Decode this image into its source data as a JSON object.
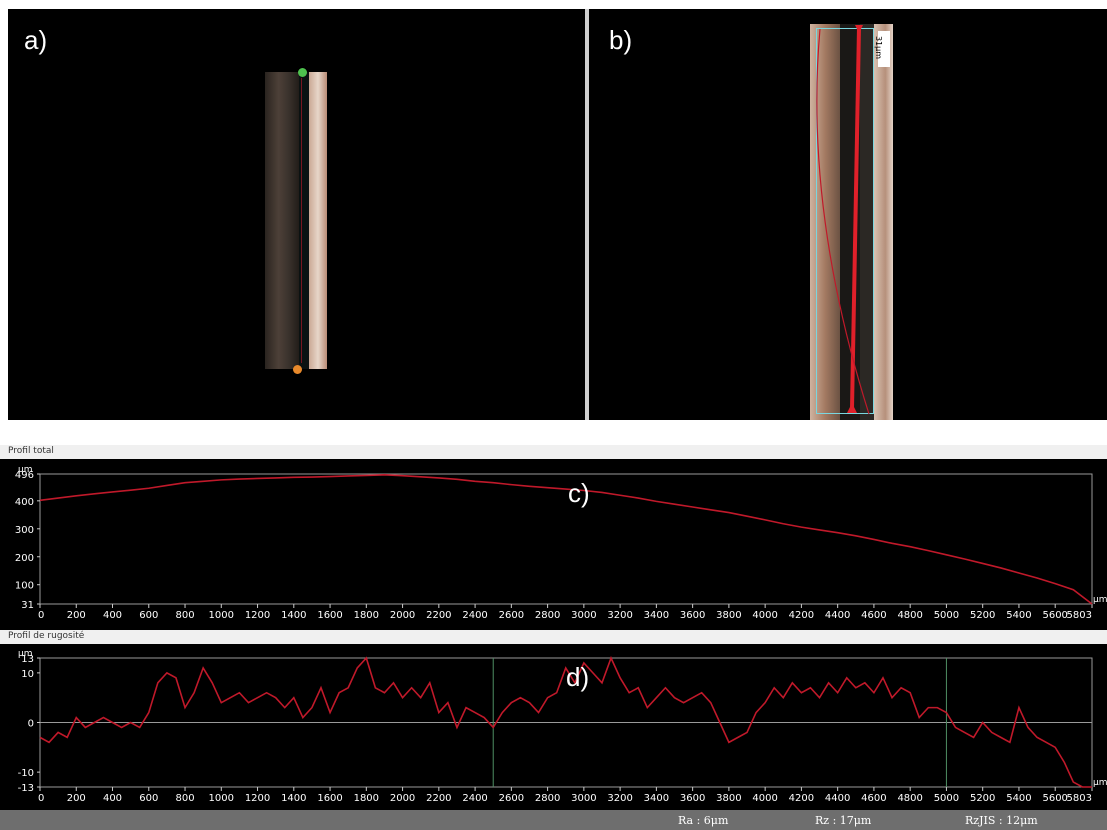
{
  "panels": {
    "a_label": "a)",
    "b_label": "b)",
    "c_label": "c)",
    "d_label": "d)",
    "b_marker_text": "31μm"
  },
  "colors": {
    "profile_line": "#c0192a",
    "grid_line": "#9a9a9a",
    "green_marker": "#4ec24e",
    "orange_marker": "#e8892b",
    "cyan_box": "#7ad7e0",
    "red_marker": "#e0202a"
  },
  "chart_data": [
    {
      "type": "line",
      "title": "Profil total",
      "ylabel": "μm",
      "xlabel": "μm",
      "xlim": [
        0,
        5803
      ],
      "ylim": [
        31,
        496
      ],
      "xticks": [
        "0",
        "200",
        "400",
        "600",
        "800",
        "1000",
        "1200",
        "1400",
        "1600",
        "1800",
        "2000",
        "2200",
        "2400",
        "2600",
        "2800",
        "3000",
        "3200",
        "3400",
        "3600",
        "3800",
        "4000",
        "4200",
        "4400",
        "4600",
        "4800",
        "5000",
        "5200",
        "5400",
        "5600",
        "5803"
      ],
      "yticks": [
        "496",
        "400",
        "300",
        "200",
        "100",
        "31"
      ],
      "series": [
        {
          "x": [
            0,
            100,
            200,
            300,
            400,
            500,
            600,
            700,
            800,
            900,
            1000,
            1100,
            1200,
            1300,
            1400,
            1500,
            1600,
            1700,
            1800,
            1900,
            2000,
            2100,
            2200,
            2300,
            2400,
            2500,
            2600,
            2700,
            2800,
            2900,
            3000,
            3100,
            3200,
            3300,
            3400,
            3500,
            3600,
            3700,
            3800,
            3900,
            4000,
            4100,
            4200,
            4300,
            4400,
            4500,
            4600,
            4700,
            4800,
            4900,
            5000,
            5100,
            5200,
            5300,
            5400,
            5500,
            5600,
            5700,
            5803
          ],
          "y": [
            402,
            410,
            418,
            425,
            432,
            438,
            445,
            455,
            465,
            470,
            475,
            478,
            480,
            482,
            484,
            485,
            487,
            489,
            491,
            493,
            490,
            486,
            482,
            477,
            470,
            465,
            458,
            452,
            447,
            442,
            437,
            430,
            420,
            410,
            398,
            388,
            378,
            368,
            358,
            345,
            332,
            318,
            306,
            296,
            286,
            275,
            262,
            248,
            236,
            222,
            207,
            192,
            176,
            160,
            142,
            124,
            104,
            82,
            31
          ]
        }
      ]
    },
    {
      "type": "line",
      "title": "Profil de rugosité",
      "ylabel": "μm",
      "xlabel": "μm",
      "xlim": [
        0,
        5803
      ],
      "ylim": [
        -13,
        13
      ],
      "xticks": [
        "0",
        "200",
        "400",
        "600",
        "800",
        "1000",
        "1200",
        "1400",
        "1600",
        "1800",
        "2000",
        "2200",
        "2400",
        "2600",
        "2800",
        "3000",
        "3200",
        "3400",
        "3600",
        "3800",
        "4000",
        "4200",
        "4400",
        "4600",
        "4800",
        "5000",
        "5200",
        "5400",
        "5600",
        "5803"
      ],
      "yticks": [
        "13",
        "10",
        "0",
        "-10",
        "-13"
      ],
      "markers_x": [
        2500,
        5000
      ],
      "series": [
        {
          "x": [
            0,
            50,
            100,
            150,
            200,
            250,
            300,
            350,
            400,
            450,
            500,
            550,
            600,
            650,
            700,
            750,
            800,
            850,
            900,
            950,
            1000,
            1050,
            1100,
            1150,
            1200,
            1250,
            1300,
            1350,
            1400,
            1450,
            1500,
            1550,
            1600,
            1650,
            1700,
            1750,
            1800,
            1850,
            1900,
            1950,
            2000,
            2050,
            2100,
            2150,
            2200,
            2250,
            2300,
            2350,
            2400,
            2450,
            2500,
            2550,
            2600,
            2650,
            2700,
            2750,
            2800,
            2850,
            2900,
            2950,
            3000,
            3050,
            3100,
            3150,
            3200,
            3250,
            3300,
            3350,
            3400,
            3450,
            3500,
            3550,
            3600,
            3650,
            3700,
            3750,
            3800,
            3850,
            3900,
            3950,
            4000,
            4050,
            4100,
            4150,
            4200,
            4250,
            4300,
            4350,
            4400,
            4450,
            4500,
            4550,
            4600,
            4650,
            4700,
            4750,
            4800,
            4850,
            4900,
            4950,
            5000,
            5050,
            5100,
            5150,
            5200,
            5250,
            5300,
            5350,
            5400,
            5450,
            5500,
            5550,
            5600,
            5650,
            5700,
            5750,
            5803
          ],
          "y": [
            -3,
            -4,
            -2,
            -3,
            1,
            -1,
            0,
            1,
            0,
            -1,
            0,
            -1,
            2,
            8,
            10,
            9,
            3,
            6,
            11,
            8,
            4,
            5,
            6,
            4,
            5,
            6,
            5,
            3,
            5,
            1,
            3,
            7,
            2,
            6,
            7,
            11,
            13,
            7,
            6,
            8,
            5,
            7,
            5,
            8,
            2,
            4,
            -1,
            3,
            2,
            1,
            -1,
            2,
            4,
            5,
            4,
            2,
            5,
            6,
            11,
            8,
            12,
            10,
            8,
            13,
            9,
            6,
            7,
            3,
            5,
            7,
            5,
            4,
            5,
            6,
            4,
            0,
            -4,
            -3,
            -2,
            2,
            4,
            7,
            5,
            8,
            6,
            7,
            5,
            8,
            6,
            9,
            7,
            8,
            6,
            9,
            5,
            7,
            6,
            1,
            3,
            3,
            2,
            -1,
            -2,
            -3,
            0,
            -2,
            -3,
            -4,
            3,
            -1,
            -3,
            -4,
            -5,
            -8,
            -12,
            -13,
            -13
          ]
        }
      ]
    }
  ],
  "status_bar": {
    "ra": "Ra : 6μm",
    "rz": "Rz : 17μm",
    "rzjis": "RzJIS : 12μm"
  }
}
